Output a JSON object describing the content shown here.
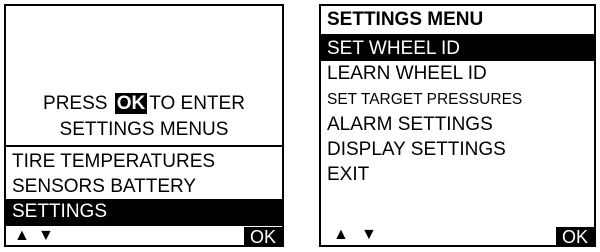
{
  "left_screen": {
    "prompt_before": "PRESS",
    "prompt_ok": "OK",
    "prompt_after": "TO ENTER",
    "prompt_line2": "SETTINGS MENUS",
    "menu_items": [
      "TIRE TEMPERATURES",
      "SENSORS BATTERY",
      "SETTINGS"
    ],
    "selected_item": "SETTINGS",
    "up_arrow": "▲",
    "down_arrow": "▼",
    "ok_label": "OK"
  },
  "right_screen": {
    "title": "SETTINGS MENU",
    "menu_items": [
      "SET WHEEL ID",
      "LEARN WHEEL ID",
      "SET TARGET PRESSURES",
      "ALARM SETTINGS",
      "DISPLAY SETTINGS",
      "EXIT"
    ],
    "selected_item": "SET WHEEL ID",
    "up_arrow": "▲",
    "down_arrow": "▼",
    "ok_label": "OK"
  },
  "colors": {
    "foreground": "#000000",
    "background": "#ffffff"
  }
}
